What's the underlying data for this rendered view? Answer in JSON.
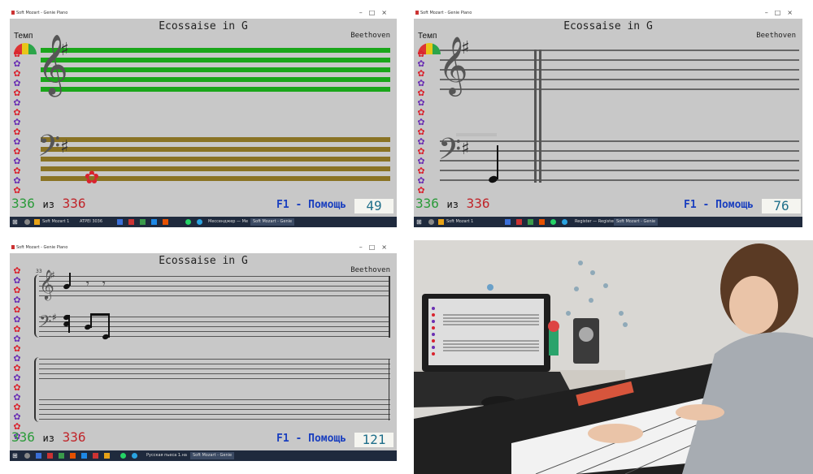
{
  "app": {
    "window_title": "Soft Mozart - Genie Piano",
    "song_title": "Ecossaise in G",
    "composer": "Beethoven",
    "tempo_label": "Темп",
    "help_label": "F1 - Помощь",
    "of_label": "из",
    "taskbar_items": [
      "Soft Mozart 1",
      "ATPEI 3036",
      "Мессенджер — Ме",
      "Soft Mozart - Genie"
    ],
    "taskbar_items_2": [
      "Soft Mozart 1",
      "Register — Register",
      "Soft Mozart - Genie"
    ],
    "taskbar_items_3": [
      "Русская пьеса 1.на",
      "Soft Mozart - Genie"
    ]
  },
  "panels": [
    {
      "current": "336",
      "total": "336",
      "score": "49",
      "measure_label": ""
    },
    {
      "current": "336",
      "total": "336",
      "score": "76",
      "measure_label": ""
    },
    {
      "current": "336",
      "total": "336",
      "score": "121",
      "measure_label": "33"
    }
  ],
  "colors": {
    "app_bg": "#c8c8c8",
    "treble_green": "#1aa61a",
    "bass_gold": "#8a7324",
    "counter_green": "#2b9b3a",
    "counter_red": "#c0252a",
    "help_blue": "#1a3fbf",
    "score_teal": "#1f6f8a",
    "flower_red": "#d9232e",
    "flower_purple": "#6a2fb3",
    "taskbar": "#1f2a3d"
  },
  "icons": {
    "flower": "flower-icon",
    "treble_clef": "treble-clef-icon",
    "bass_clef": "bass-clef-icon",
    "sharp": "sharp-icon",
    "tempo_gauge": "tempo-gauge-icon"
  },
  "photo": {
    "description_visible": "",
    "keyboard_brand": "",
    "laptop_brand": ""
  }
}
